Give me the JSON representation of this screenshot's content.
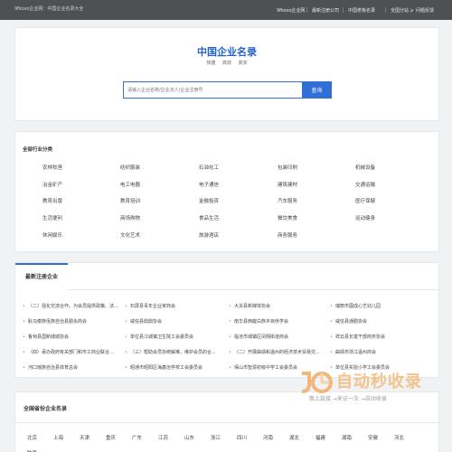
{
  "topbar": {
    "site_name": "9fkoso企业网：中国企业名录大全",
    "brand": "9fkoso企业网",
    "nav": [
      "最新注册公司",
      "中国老板名录",
      "全国分站",
      "问题反馈"
    ],
    "dropdown_icon": "chevron-down-icon"
  },
  "hero": {
    "title": "中国企业名录",
    "tags": [
      "快捷",
      "高效",
      "真实"
    ],
    "search_placeholder": "请输入企业名称/企业法人/企业注册号",
    "search_button": "查询"
  },
  "industry": {
    "title": "全部行业分类",
    "items": [
      "农林牧渔",
      "纺织服装",
      "石油化工",
      "包装印刷",
      "机械设备",
      "冶金矿产",
      "电工电器",
      "电子通信",
      "建筑建材",
      "交通运输",
      "教育出版",
      "教育培训",
      "金融投资",
      "汽车服务",
      "医疗保健",
      "生活便利",
      "商场购物",
      "食品生活",
      "餐饮美食",
      "运动健身",
      "休闲娱乐",
      "文化艺术",
      "旅游酒店",
      "商务服务",
      ""
    ]
  },
  "latest": {
    "title": "最新注册企业",
    "items": [
      "（二）强化交流合作。为会员提供政策、法...",
      "石屏县青年企业家商会",
      "大关县新媒体协会",
      "瑞丽市國成心艺幼儿园",
      "耿马傣族佤族自治县勤永商会",
      "威信县鼎鼎协会",
      "南华县西靛白族乡目侨学会",
      "威信县通勤协会",
      "鲁甸县国新储城协会",
      "单位县江城镇卫生院工会委员会",
      "临沧市城镇区凤翔街道商会",
      "祥云县长富干部商务协会",
      "（四）承办政府有关部门和市工商业联合...",
      "（三）帮助会员协统解难，维护会员的合...",
      "（二）开展曲靖和温州的经济技术贸易交...",
      "曲靖市浙江温州商会",
      "河口瑶族自治县体育总会",
      "昭通市昭阳区海鑫治学校工会委员会",
      "保山市智源初级中学工会委员会",
      "单位县实验小学工会委员会"
    ]
  },
  "provinces": {
    "title": "全国省份企业名录",
    "items": [
      "北京",
      "上海",
      "天津",
      "重庆",
      "广东",
      "江苏",
      "山东",
      "浙江",
      "四川",
      "河南",
      "湖北",
      "福建",
      "湖南",
      "安徽",
      "河北",
      "陕西"
    ]
  },
  "watermark": {
    "name": "自动秒收录",
    "slogan": "敬上链接 →来访一次 →自动收录"
  },
  "colors": {
    "accent": "#2f6fd6",
    "title_blue": "#2563c9",
    "topbar": "#4e5154",
    "background": "#f1f2f4"
  }
}
